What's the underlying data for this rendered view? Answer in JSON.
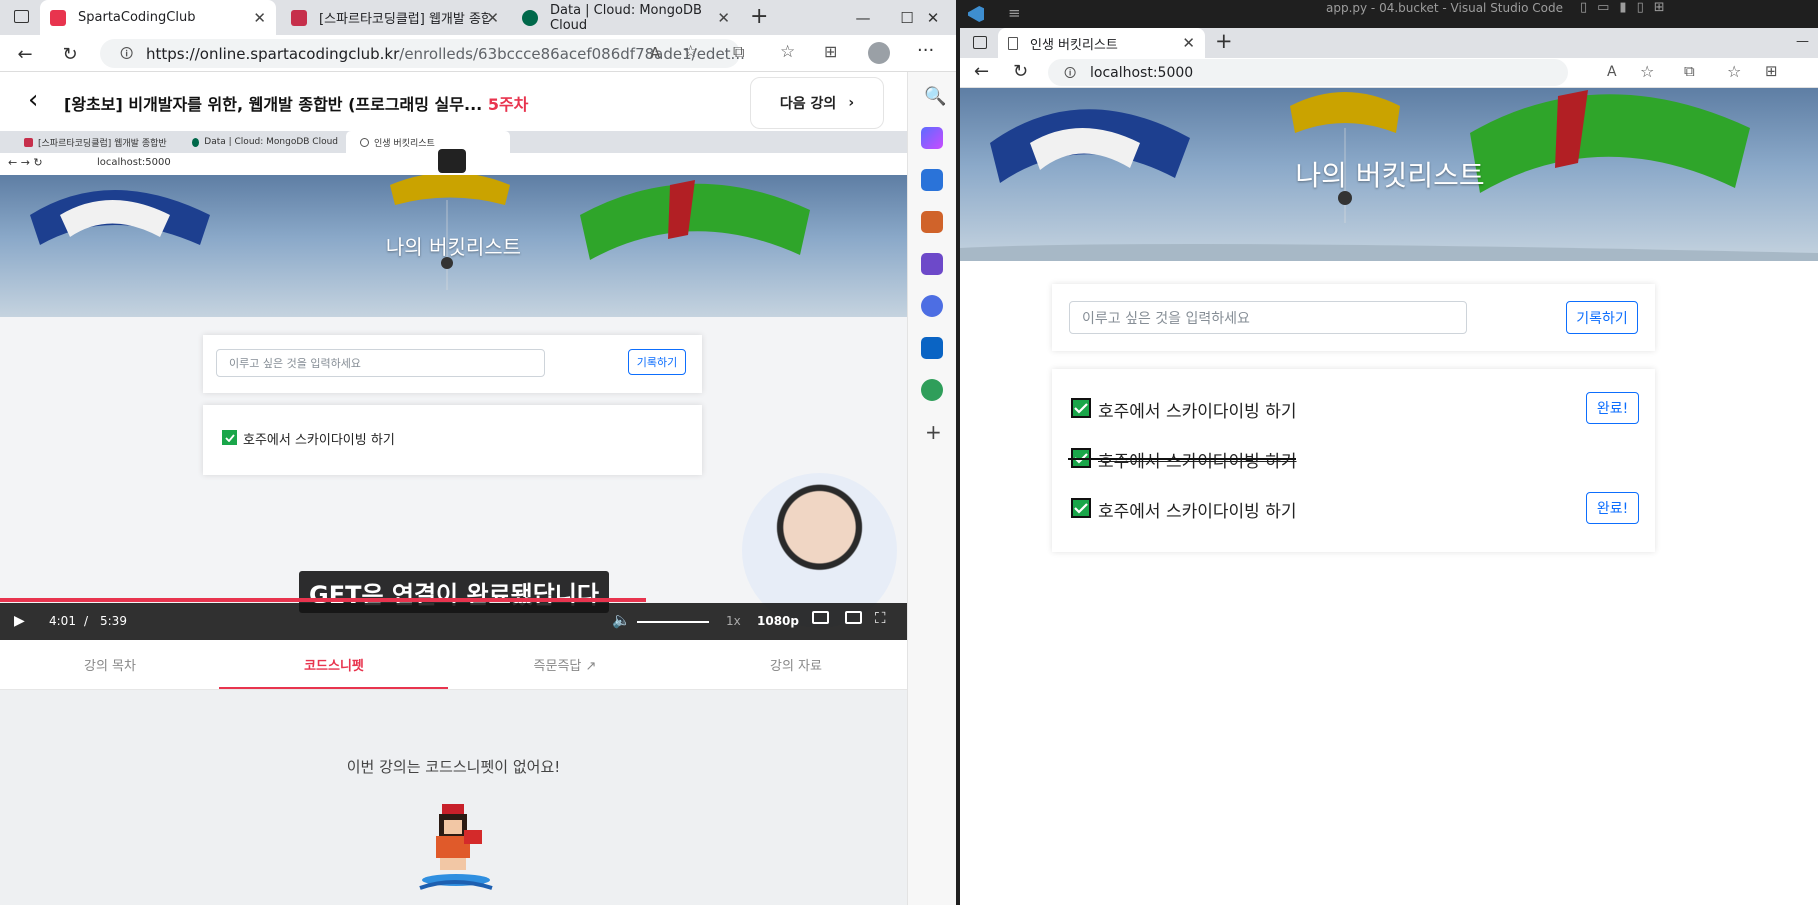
{
  "left_browser": {
    "tabs": [
      {
        "title": "SpartaCodingClub",
        "active": true
      },
      {
        "title": "[스파르타코딩클럽] 웹개발 종합",
        "active": false
      },
      {
        "title": "Data | Cloud: MongoDB Cloud",
        "active": false
      }
    ],
    "url_host": "https://online.spartacodingclub.kr",
    "url_path": "/enrolleds/63bccce86acef086df78ade1/edet..."
  },
  "course": {
    "title": "[왕초보] 비개발자를 위한, 웹개발 종합반 (프로그래밍 실무...",
    "week": "5주차",
    "next_button": "다음 강의"
  },
  "video": {
    "inner_tabs": [
      "[스파르타코딩클럽] 웹개발 종합반",
      "Data | Cloud: MongoDB Cloud",
      "인생 버킷리스트"
    ],
    "inner_url": "localhost:5000",
    "page_title": "나의 버킷리스트",
    "input_placeholder": "이루고 싶은 것을 입력하세요",
    "submit_label": "기록하기",
    "items": [
      {
        "text": "호주에서 스카이다이빙 하기",
        "done": false
      }
    ],
    "subtitle": "GET은 연결이 완료됐답니다",
    "time_current": "4:01",
    "time_sep": "/",
    "time_total": "5:39",
    "speed": "1x",
    "quality": "1080p",
    "progress": 0.712
  },
  "course_tabs": [
    {
      "label": "강의 목차",
      "active": false
    },
    {
      "label": "코드스니펫",
      "active": true
    },
    {
      "label": "즉문즉답",
      "active": false
    },
    {
      "label": "강의 자료",
      "active": false
    }
  ],
  "snippet": {
    "empty_text": "이번 강의는 코드스니펫이 없어요!"
  },
  "vscode": {
    "window_title": "app.py - 04.bucket - Visual Studio Code"
  },
  "right_browser": {
    "tab_title": "인생 버킷리스트",
    "url": "localhost:5000",
    "page_title": "나의 버킷리스트",
    "input_placeholder": "이루고 싶은 것을 입력하세요",
    "submit_label": "기록하기",
    "done_label": "완료!",
    "items": [
      {
        "text": "호주에서 스카이다이빙 하기",
        "done": false
      },
      {
        "text": "호주에서 스카이다이빙 하기",
        "done": true
      },
      {
        "text": "호주에서 스카이다이빙 하기",
        "done": false
      }
    ]
  },
  "colors": {
    "accent_red": "#e8344e",
    "bootstrap_blue": "#0d6efd",
    "check_green": "#1aa64a"
  }
}
